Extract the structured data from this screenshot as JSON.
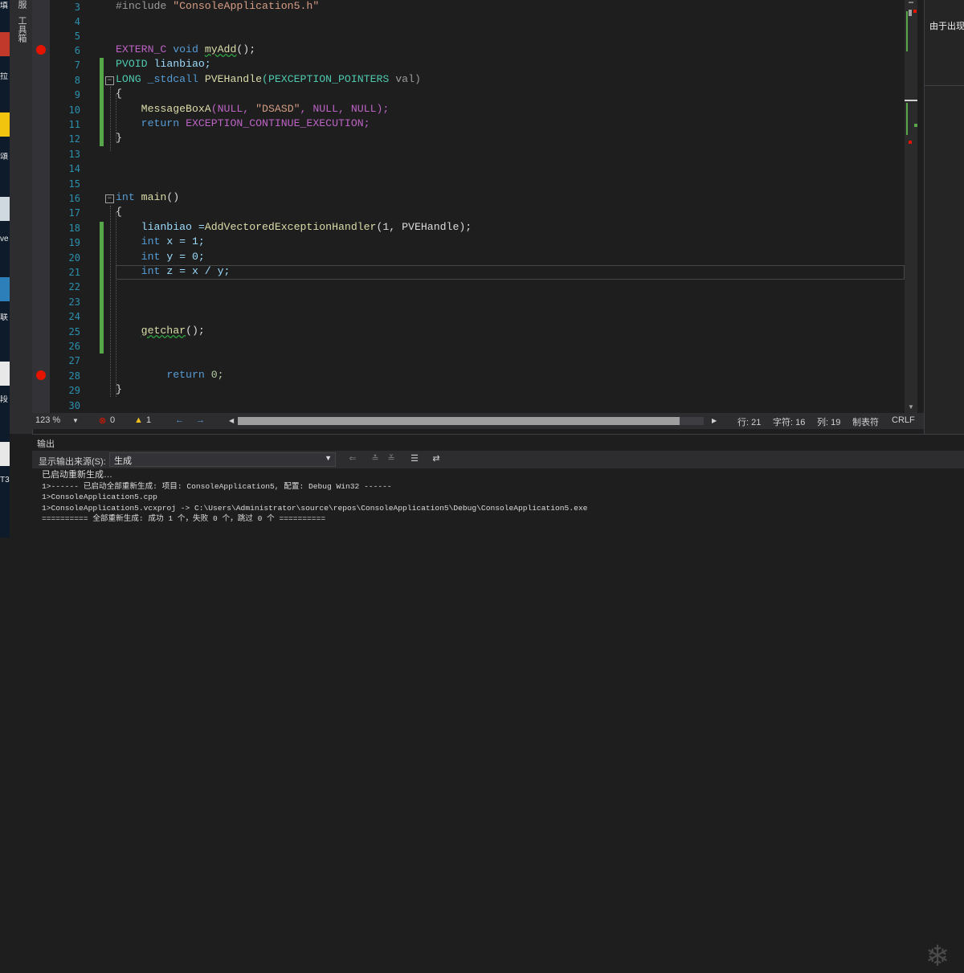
{
  "desktop": {
    "icon_labels": [
      "填",
      "拉",
      "頌",
      "ve",
      "联",
      "段",
      "T3"
    ]
  },
  "toolbox": {
    "tab_server": "服",
    "tab_toolbox": "工具箱"
  },
  "editor": {
    "lines": [
      {
        "n": "3"
      },
      {
        "n": "4"
      },
      {
        "n": "5"
      },
      {
        "n": "6"
      },
      {
        "n": "7"
      },
      {
        "n": "8"
      },
      {
        "n": "9"
      },
      {
        "n": "10"
      },
      {
        "n": "11"
      },
      {
        "n": "12"
      },
      {
        "n": "13"
      },
      {
        "n": "14"
      },
      {
        "n": "15"
      },
      {
        "n": "16"
      },
      {
        "n": "17"
      },
      {
        "n": "18"
      },
      {
        "n": "19"
      },
      {
        "n": "20"
      },
      {
        "n": "21"
      },
      {
        "n": "22"
      },
      {
        "n": "23"
      },
      {
        "n": "24"
      },
      {
        "n": "25"
      },
      {
        "n": "26"
      },
      {
        "n": "27"
      },
      {
        "n": "28"
      },
      {
        "n": "29"
      },
      {
        "n": "30"
      }
    ],
    "code": {
      "l3_include": "#include ",
      "l3_header": "\"ConsoleApplication5.h\"",
      "l6_macro": "EXTERN_C",
      "l6_kw": "void",
      "l6_fn": "myAdd",
      "l6_rest": "();",
      "l7_type": "PVOID",
      "l7_rest": "lianbiao;",
      "l8_type": "LONG",
      "l8_cc": "_stdcall",
      "l8_fn": "PVEHandle",
      "l8_ptype": "(PEXCEPTION_POINTERS",
      "l8_rest": "val)",
      "l9": "{",
      "l10_fn": "MessageBoxA",
      "l10_a": "(NULL, ",
      "l10_str": "\"DSASD\"",
      "l10_b": ", NULL, NULL);",
      "l11_kw": "return",
      "l11_rest": "EXCEPTION_CONTINUE_EXECUTION;",
      "l12": "}",
      "l16_kw": "int",
      "l16_fn": "main",
      "l16_rest": "()",
      "l17": "{",
      "l18_a": "lianbiao =",
      "l18_fn": "AddVectoredExceptionHandler",
      "l18_b": "(1, PVEHandle);",
      "l19_kw": "int",
      "l19_rest": "x = 1;",
      "l20_kw": "int",
      "l20_rest": "y = 0;",
      "l21_kw": "int",
      "l21_rest": "z = x / y;",
      "l25_fn": "getchar",
      "l25_rest": "();",
      "l28_kw": "return",
      "l28_rest": "0;",
      "l29": "}"
    }
  },
  "right_panel": {
    "text": "由于出现"
  },
  "status_bar": {
    "zoom": "123 %",
    "errors": "0",
    "warnings": "1",
    "line": "行: 21",
    "char": "字符: 16",
    "col": "列: 19",
    "tabs": "制表符",
    "eol": "CRLF"
  },
  "output": {
    "title": "输出",
    "source_label": "显示输出来源(S):",
    "source_value": "生成",
    "lines": [
      "已启动重新生成…",
      "1>------ 已启动全部重新生成: 项目: ConsoleApplication5, 配置: Debug Win32 ------",
      "1>ConsoleApplication5.cpp",
      "1>ConsoleApplication5.vcxproj -> C:\\Users\\Administrator\\source\\repos\\ConsoleApplication5\\Debug\\ConsoleApplication5.exe",
      "========== 全部重新生成: 成功 1 个，失败 0 个，跳过 0 个 =========="
    ]
  },
  "colors": {
    "breakpoint": "#e51400",
    "line_number": "#2b91af",
    "keyword": "#569cd6",
    "string": "#d69d85",
    "function": "#dcdcaa",
    "changed": "#57a64a"
  }
}
